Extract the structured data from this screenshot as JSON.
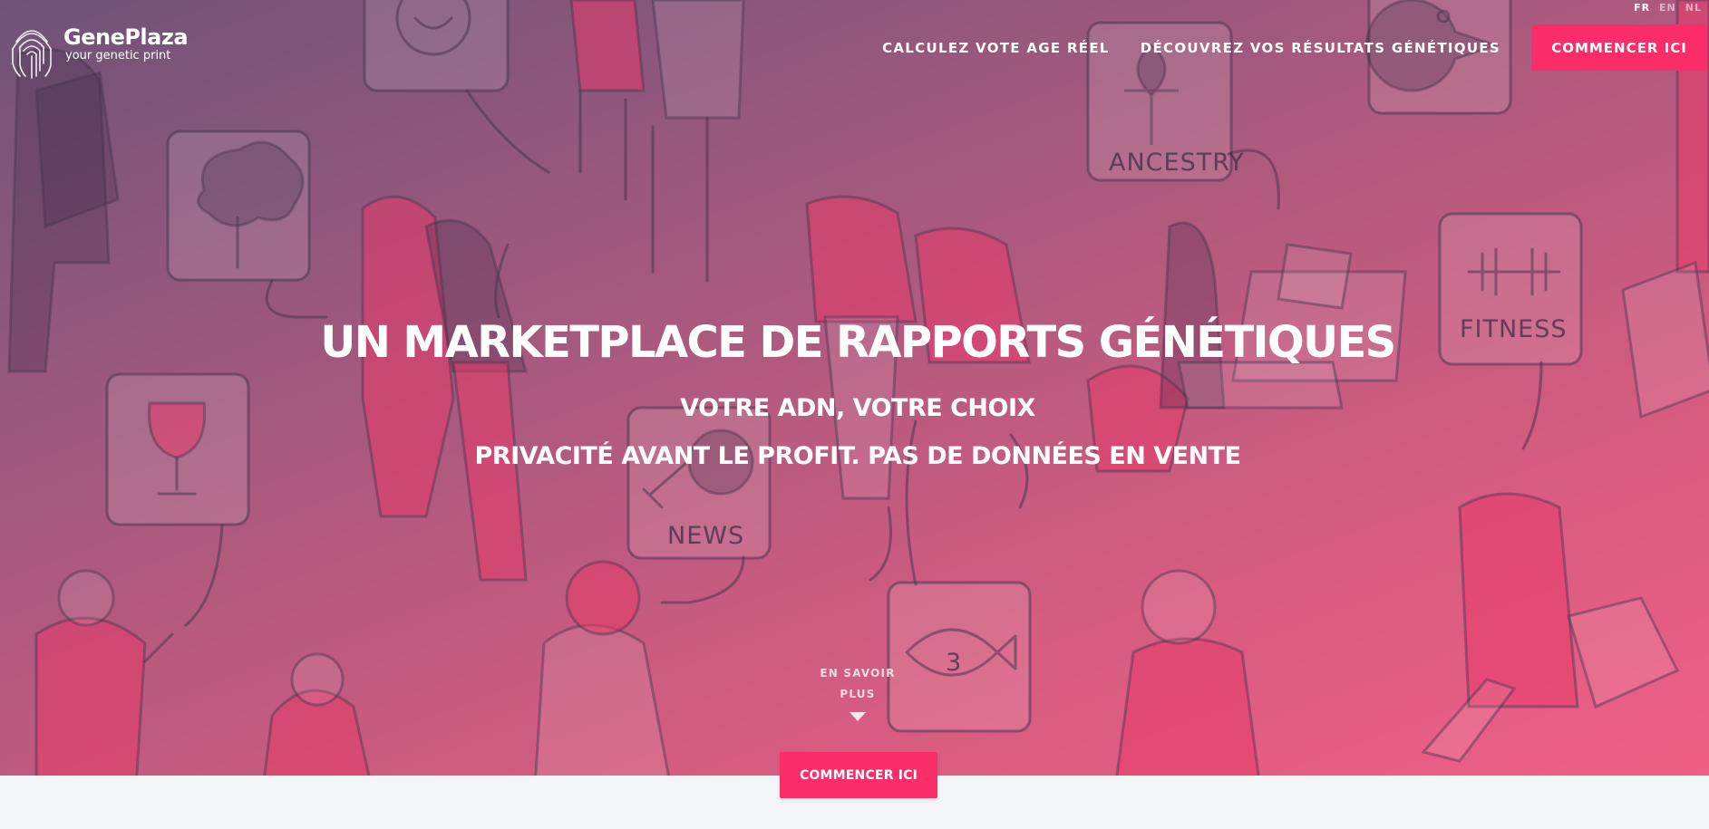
{
  "brand": {
    "name": "GenePlaza",
    "tagline": "your genetic print",
    "logo_icon": "fingerprint-icon"
  },
  "languages": [
    {
      "label": "FR",
      "active": true
    },
    {
      "label": "EN",
      "active": false
    },
    {
      "label": "NL",
      "active": false
    }
  ],
  "nav": {
    "links": [
      "CALCULEZ VOTE AGE RÉEL",
      "DÉCOUVREZ VOS RÉSULTATS GÉNÉTIQUES"
    ],
    "cta": "COMMENCER ICI"
  },
  "hero": {
    "title": "UN MARKETPLACE DE RAPPORTS GÉNÉTIQUES",
    "subtitle1": "VOTRE ADN, VOTRE CHOIX",
    "subtitle2": "PRIVACITÉ AVANT LE PROFIT. PAS DE DONNÉES EN VENTE",
    "more_line1": "EN SAVOIR",
    "more_line2": "PLUS",
    "more_icon": "caret-down-icon",
    "cta": "COMMENCER ICI"
  },
  "illustration": {
    "bubble_labels": [
      "ANCESTRY",
      "FITNESS",
      "NEWS"
    ],
    "fish_number": "3",
    "icons": [
      "smiley-icon",
      "tree-icon",
      "wine-glass-icon",
      "ankh-icon",
      "pacman-icon",
      "dumbbell-icon",
      "megaphone-icon",
      "fish-icon",
      "laptop-icon"
    ]
  },
  "colors": {
    "accent": "#fb2d68",
    "gradient_start": "#6e5377",
    "gradient_end": "#f05f85",
    "page_bg": "#f4f5f7"
  }
}
